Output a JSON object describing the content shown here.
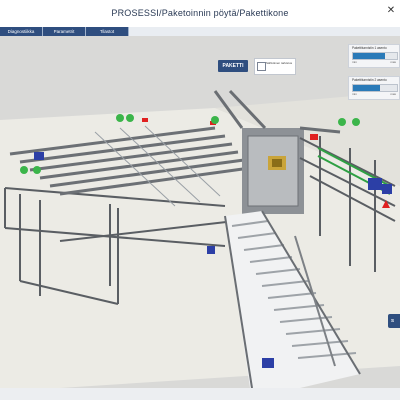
{
  "header": {
    "title": "PROSESSI/Paketoinnin pöytä/Pakettikone",
    "close_glyph": "✕"
  },
  "tabs": [
    {
      "label": "Diagnostiikka"
    },
    {
      "label": "Parametrit"
    },
    {
      "label": "Tilastot"
    }
  ],
  "controls": {
    "paketti_label": "PAKETTI",
    "manual_label": "Sähköinen tarkistus"
  },
  "sensors": [
    {
      "label": "Pakettitunnistin 1 asento",
      "min": "min",
      "max": "max",
      "value_fraction": 0.72
    },
    {
      "label": "Pakettitunnistin 2 asento",
      "min": "min",
      "max": "max",
      "value_fraction": 0.62
    }
  ],
  "side_button": {
    "label": "S"
  },
  "colors": {
    "accent": "#2f4e7f",
    "ok_status": "#3bb54a",
    "alarm": "#e02020",
    "motor": "#2c3fa6",
    "steel": "#5f6368",
    "floor": "#d9d9d7"
  }
}
